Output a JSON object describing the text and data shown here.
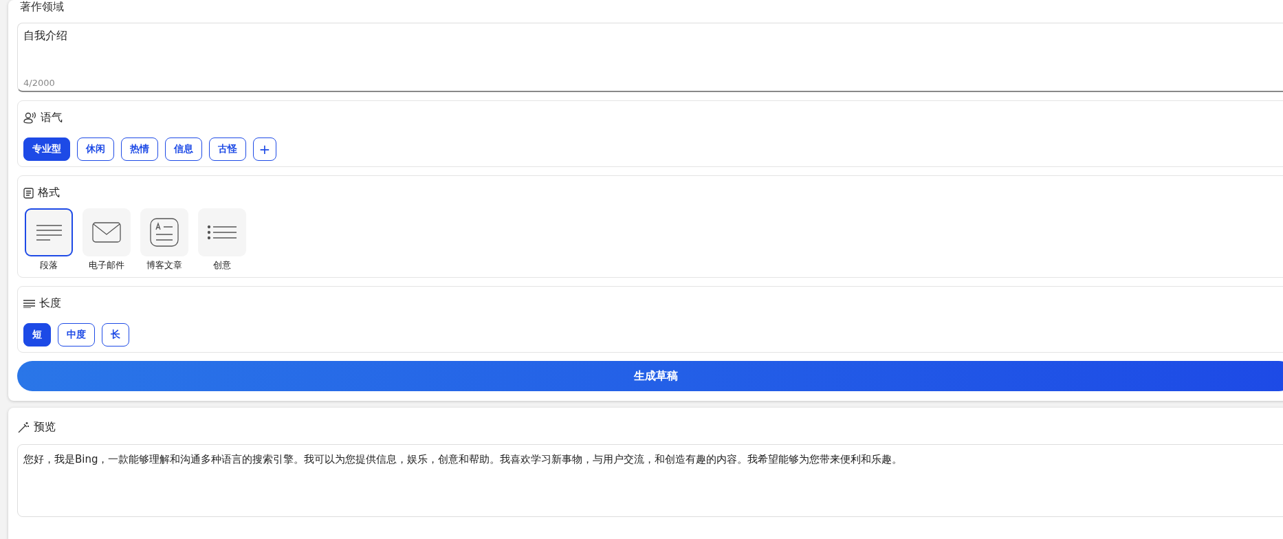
{
  "topic": {
    "label": "著作领域",
    "value": "自我介绍",
    "counter": "4/2000"
  },
  "tone": {
    "title": "语气",
    "options": [
      {
        "label": "专业型",
        "selected": true
      },
      {
        "label": "休闲",
        "selected": false
      },
      {
        "label": "热情",
        "selected": false
      },
      {
        "label": "信息",
        "selected": false
      },
      {
        "label": "古怪",
        "selected": false
      }
    ],
    "add": "+"
  },
  "format": {
    "title": "格式",
    "options": [
      {
        "label": "段落",
        "kind": "paragraph",
        "selected": true
      },
      {
        "label": "电子邮件",
        "kind": "email",
        "selected": false
      },
      {
        "label": "博客文章",
        "kind": "blog",
        "selected": false
      },
      {
        "label": "创意",
        "kind": "list",
        "selected": false
      }
    ]
  },
  "length": {
    "title": "长度",
    "options": [
      {
        "label": "短",
        "selected": true
      },
      {
        "label": "中度",
        "selected": false
      },
      {
        "label": "长",
        "selected": false
      }
    ]
  },
  "generate_button": "生成草稿",
  "preview": {
    "title": "预览",
    "text": "您好，我是Bing，一款能够理解和沟通多种语言的搜索引擎。我可以为您提供信息，娱乐，创意和帮助。我喜欢学习新事物，与用户交流，和创造有趣的内容。我希望能够为您带来便利和乐趣。"
  }
}
